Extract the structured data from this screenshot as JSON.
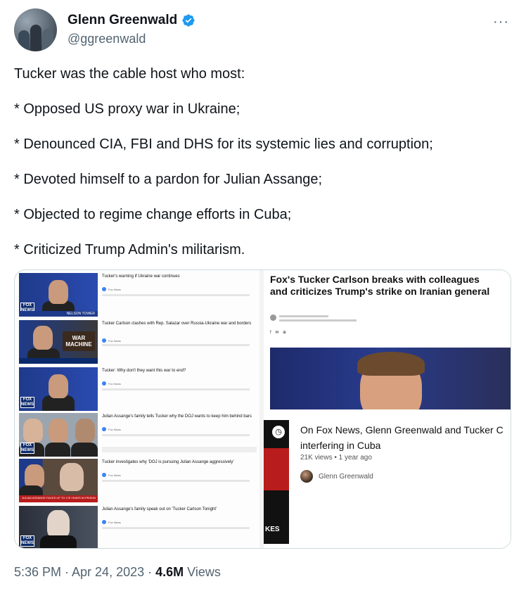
{
  "author": {
    "name": "Glenn Greenwald",
    "handle": "@ggreenwald"
  },
  "more_icon": "more-horizontal-icon",
  "tweet": {
    "lines": [
      "Tucker was the cable host who most:",
      "* Opposed US proxy war in Ukraine;",
      "* Denounced CIA, FBI and DHS for its systemic lies and corruption;",
      "* Devoted himself to a pardon for Julian Assange;",
      "* Objected to regime change efforts in Cuba;",
      "* Criticized Trump Admin's militarism."
    ]
  },
  "media": {
    "videos": [
      {
        "title": "Tucker's warning if Ukraine war continues",
        "channel": "Fox News",
        "thumb_text": "NELSON TOWER"
      },
      {
        "title": "Tucker Carlson clashes with Rep. Salazar over Russia-Ukraine war and borders",
        "channel": "Fox News",
        "thumb_text": "WAR MACHINE"
      },
      {
        "title": "Tucker: Why don't they want this war to end?",
        "channel": "Fox News",
        "thumb_text": ""
      },
      {
        "title": "Julian Assange's family tells Tucker why the DOJ wants to keep him behind bars",
        "channel": "Fox News",
        "thumb_text": ""
      },
      {
        "title": "Tucker investigates why 'DOJ is pursuing Julian Assange aggressively'",
        "channel": "Fox News",
        "thumb_text": "JULIAN ASSANGE FACES UP TO 175 YEARS IN PRISON"
      },
      {
        "title": "Julian Assange's family speak out on 'Tucker Carlson Tonight'",
        "channel": "Fox News",
        "thumb_text": ""
      }
    ],
    "article": {
      "title": "Fox's Tucker Carlson breaks with colleagues and criticizes Trump's strike on Iranian general",
      "share": "f ✉ ⊕"
    },
    "youtube": {
      "title_line1": "On Fox News, Glenn Greenwald and Tucker C",
      "title_line2": "interfering in Cuba",
      "meta": "21K views • 1 year ago",
      "channel": "Glenn Greenwald",
      "thumb_text": "KES"
    }
  },
  "footer": {
    "time": "5:36 PM · Apr 24, 2023 ·",
    "views_count": "4.6M",
    "views_label": "Views"
  },
  "colors": {
    "text": "#0f1419",
    "secondary": "#536471",
    "verified": "#1d9bf0",
    "border": "#cfd9de"
  }
}
